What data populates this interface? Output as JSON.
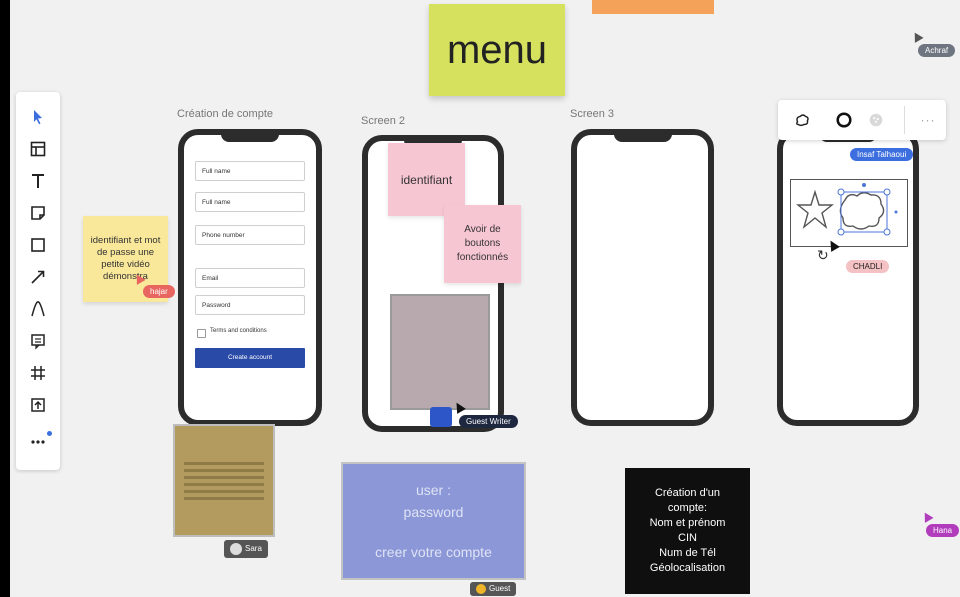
{
  "board": {
    "menu_sticky": "menu",
    "frames": {
      "frame1_label": "Création de compte",
      "frame2_label": "Screen 2",
      "frame3_label": "Screen 3"
    }
  },
  "toolbar": {
    "tools": [
      {
        "icon": "select-arrow-icon"
      },
      {
        "icon": "templates-icon"
      },
      {
        "icon": "text-icon"
      },
      {
        "icon": "sticky-note-icon"
      },
      {
        "icon": "shape-icon"
      },
      {
        "icon": "connector-arrow-icon"
      },
      {
        "icon": "pen-icon"
      },
      {
        "icon": "comment-icon"
      },
      {
        "icon": "frame-icon"
      },
      {
        "icon": "upload-icon"
      },
      {
        "icon": "more-icon"
      }
    ]
  },
  "form": {
    "field1": "Full name",
    "field2": "Full name",
    "field3": "Phone number",
    "field4": "Email",
    "field5": "Password",
    "terms": "Terms and conditions",
    "button": "Create account"
  },
  "notes": {
    "yellow_note": "identifiant et mot de passe une petite vidéo démonstra",
    "pink_note1": "identifiant",
    "pink_note2": "Avoir de boutons fonctionnés",
    "blue_note_line1": "user :",
    "blue_note_line2": "password",
    "blue_note_line3": "creer votre compte",
    "black_note_line1": "Création d'un",
    "black_note_line2": "compte:",
    "black_note_line3": "Nom et prénom",
    "black_note_line4": "CIN",
    "black_note_line5": "Num de Tél",
    "black_note_line6": "Géolocalisation"
  },
  "cursors": {
    "top_right": "Achraf",
    "hajar": "hajar",
    "guest_writer": "Guest Writer",
    "insaf": "Insaf Talhaoui",
    "chadli": "CHADLI",
    "sara": "Sara",
    "hana": "Hana",
    "guest_bottom": "Guest"
  },
  "colors": {
    "menu_sticky": "#d6e15e",
    "yellow_sticky": "#f9e79a",
    "pink_sticky": "#f7c6d3",
    "blue_sticky": "#8b97d6",
    "button_blue": "#2a4aa8",
    "accent_blue": "#3c6ee0"
  }
}
